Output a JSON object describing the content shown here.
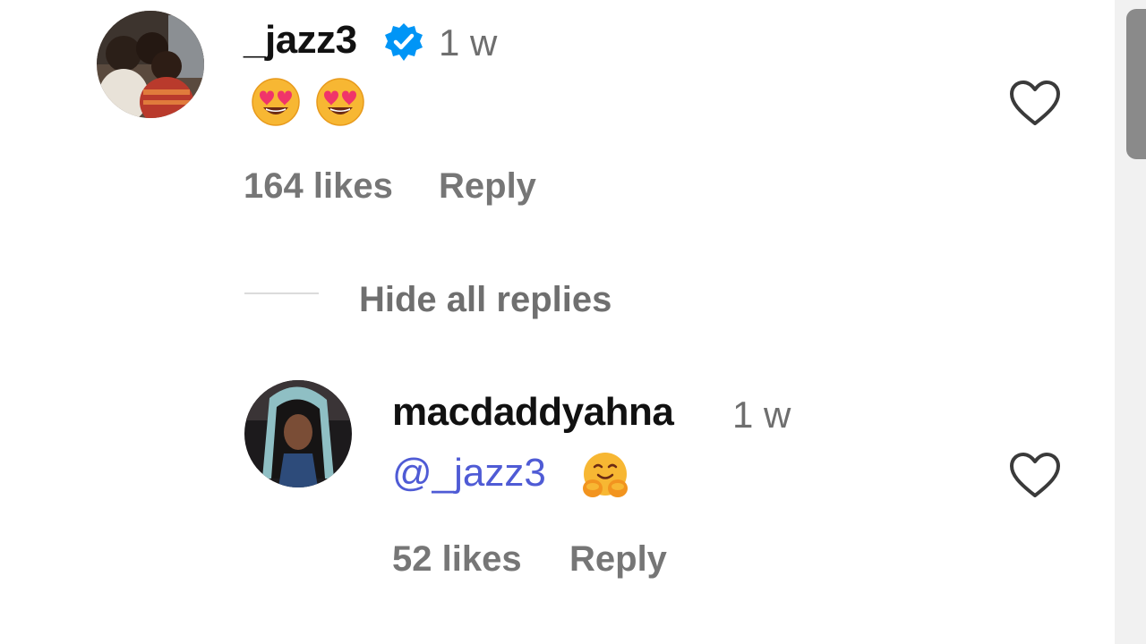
{
  "comment": {
    "username": "_jazz3",
    "time": "1 w",
    "verified_icon": "verified-badge-icon",
    "content_emojis": [
      "smiling-face-with-heart-eyes",
      "smiling-face-with-heart-eyes"
    ],
    "likes": "164 likes",
    "reply_label": "Reply",
    "like_icon": "heart-outline-icon"
  },
  "replies_toggle": {
    "label": "Hide all replies"
  },
  "reply": {
    "username": "macdaddyahna",
    "time": "1 w",
    "mention": "@_jazz3",
    "content_emojis": [
      "hugging-face"
    ],
    "likes": "52 likes",
    "reply_label": "Reply",
    "like_icon": "heart-outline-icon"
  },
  "colors": {
    "verified": "#0095f6",
    "mention": "#4f5bd5",
    "meta_text": "#767676"
  }
}
